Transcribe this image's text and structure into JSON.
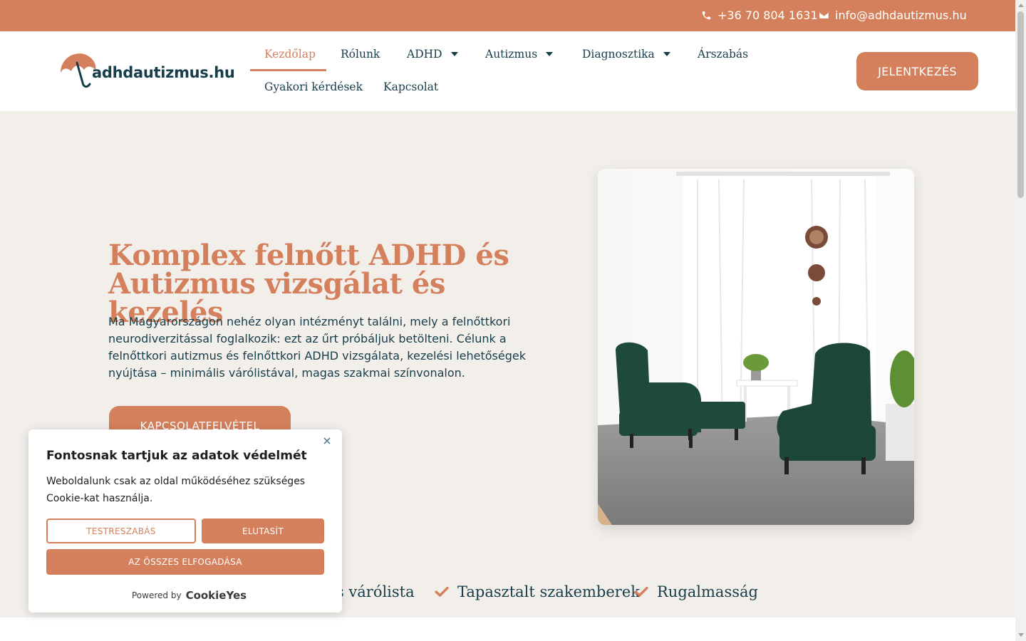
{
  "topbar": {
    "phone": "+36 70 804 1631",
    "email": "info@adhdautizmus.hu",
    "phone_icon": "phone-icon",
    "email_icon": "envelope-icon"
  },
  "header": {
    "logo_text": "adhdautizmus.hu",
    "nav": [
      {
        "label": "Kezdőlap",
        "active": true
      },
      {
        "label": "Rólunk"
      },
      {
        "label": "ADHD",
        "dropdown": true
      },
      {
        "label": "Autizmus",
        "dropdown": true
      },
      {
        "label": "Diagnosztika",
        "dropdown": true
      },
      {
        "label": "Árszabás"
      },
      {
        "label": "Gyakori kérdések"
      },
      {
        "label": "Kapcsolat"
      }
    ],
    "cta_label": "JELENTKEZÉS"
  },
  "hero": {
    "title_line1": "Komplex felnőtt ADHD és",
    "title_line2": "Autizmus vizsgálat és kezelés",
    "text": "Ma Magyarországon nehéz olyan intézményt találni, mely a felnőttkori neurodiverzitással foglalkozik: ezt az űrt próbáljuk betölteni. Célunk a felnőttkori autizmus és felnőttkori ADHD vizsgálata, kezelési lehetőségek nyújtása – minimális várólistával, magas szakmai színvonalon.",
    "button_label": "KAPCSOLATFELVÉTEL"
  },
  "features": [
    {
      "label": "ális várólista"
    },
    {
      "label": "Tapasztalt szakemberek"
    },
    {
      "label": "Rugalmasság"
    }
  ],
  "cookie": {
    "title": "Fontosnak tartjuk az adatok védelmét",
    "body": "Weboldalunk csak az oldal működéséhez szükséges Cookie-kat használja.",
    "customize": "TESTRESZABÁS",
    "reject": "ELUTASÍT",
    "accept": "AZ ÖSSZES ELFOGADÁSA",
    "powered_by": "Powered by",
    "brand": "CookieYes"
  },
  "colors": {
    "accent": "#d4805c",
    "navy": "#173c4a",
    "hero_bg": "#f2efeb"
  }
}
